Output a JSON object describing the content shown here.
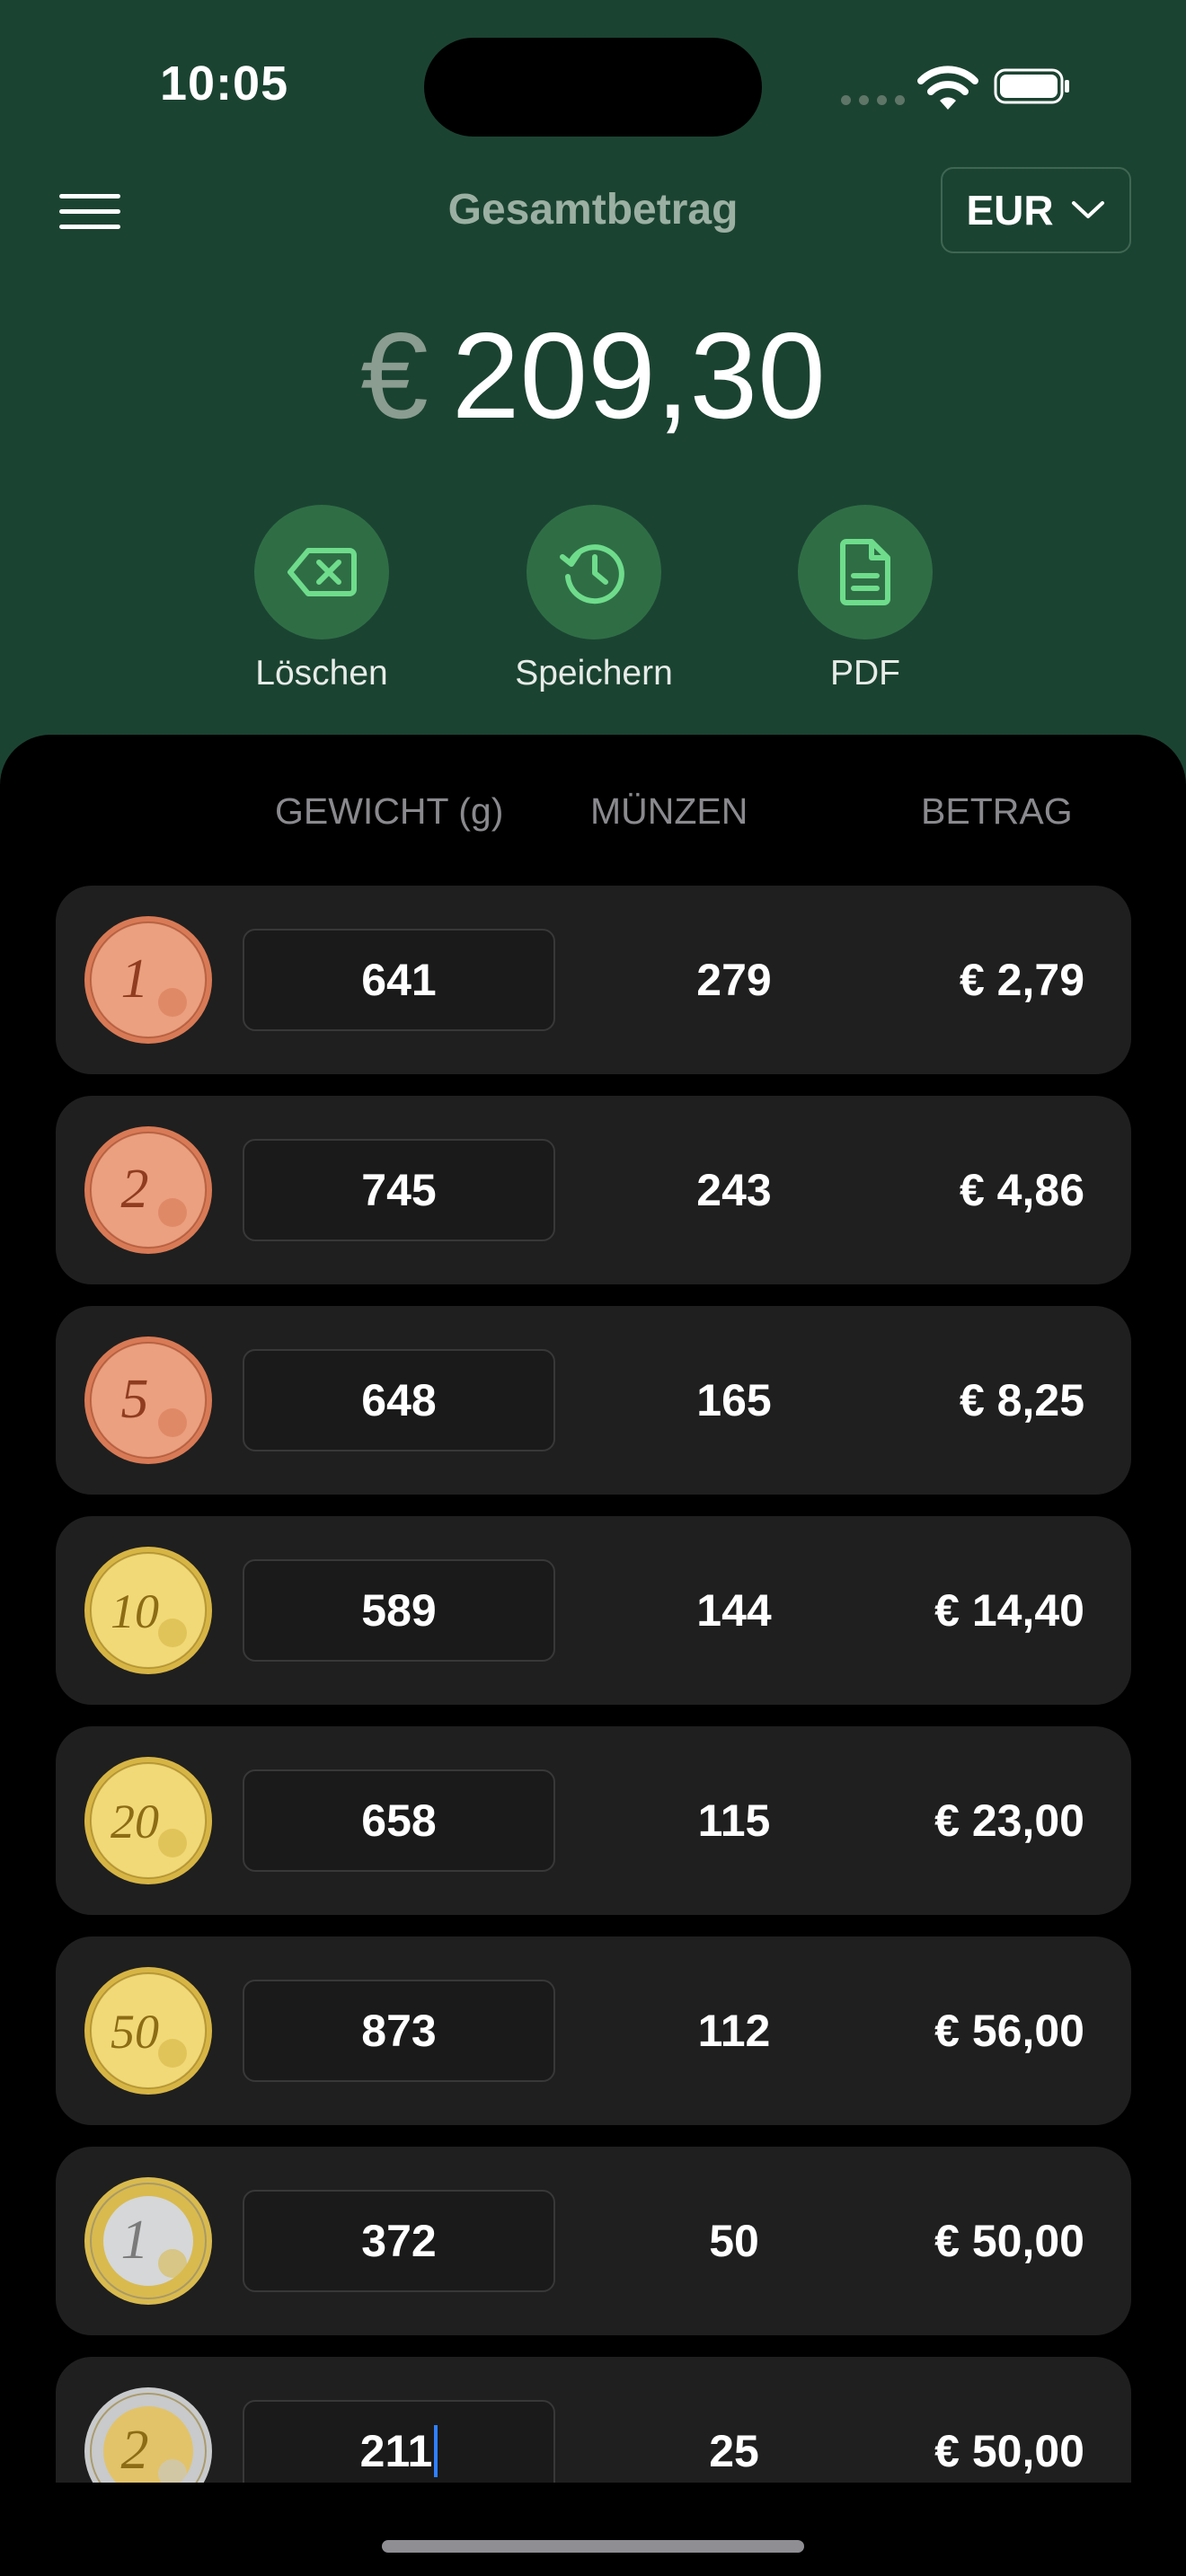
{
  "status": {
    "time": "10:05"
  },
  "header": {
    "title": "Gesamtbetrag",
    "currency": "EUR"
  },
  "total": {
    "symbol": "€",
    "amount": "209,30"
  },
  "actions": [
    {
      "label": "Löschen",
      "icon": "delete-backspace-icon"
    },
    {
      "label": "Speichern",
      "icon": "history-save-icon"
    },
    {
      "label": "PDF",
      "icon": "document-pdf-icon"
    }
  ],
  "columns": {
    "weight": "GEWICHT (g)",
    "coins": "MÜNZEN",
    "amount": "BETRAG"
  },
  "rows": [
    {
      "coin": "1 Cent",
      "numeral": "1",
      "weight": "641",
      "count": "279",
      "amount": "€ 2,79"
    },
    {
      "coin": "2 Cent",
      "numeral": "2",
      "weight": "745",
      "count": "243",
      "amount": "€ 4,86"
    },
    {
      "coin": "5 Cent",
      "numeral": "5",
      "weight": "648",
      "count": "165",
      "amount": "€ 8,25"
    },
    {
      "coin": "10 Cent",
      "numeral": "10",
      "weight": "589",
      "count": "144",
      "amount": "€ 14,40"
    },
    {
      "coin": "20 Cent",
      "numeral": "20",
      "weight": "658",
      "count": "115",
      "amount": "€ 23,00"
    },
    {
      "coin": "50 Cent",
      "numeral": "50",
      "weight": "873",
      "count": "112",
      "amount": "€ 56,00"
    },
    {
      "coin": "1 Euro",
      "numeral": "1",
      "weight": "372",
      "count": "50",
      "amount": "€ 50,00"
    },
    {
      "coin": "2 Euro",
      "numeral": "2",
      "weight": "211",
      "count": "25",
      "amount": "€ 50,00"
    }
  ],
  "colors": {
    "header_bg": "#1b4332",
    "accent_green": "#6fdc8c",
    "row_bg": "#1f1f1f"
  }
}
